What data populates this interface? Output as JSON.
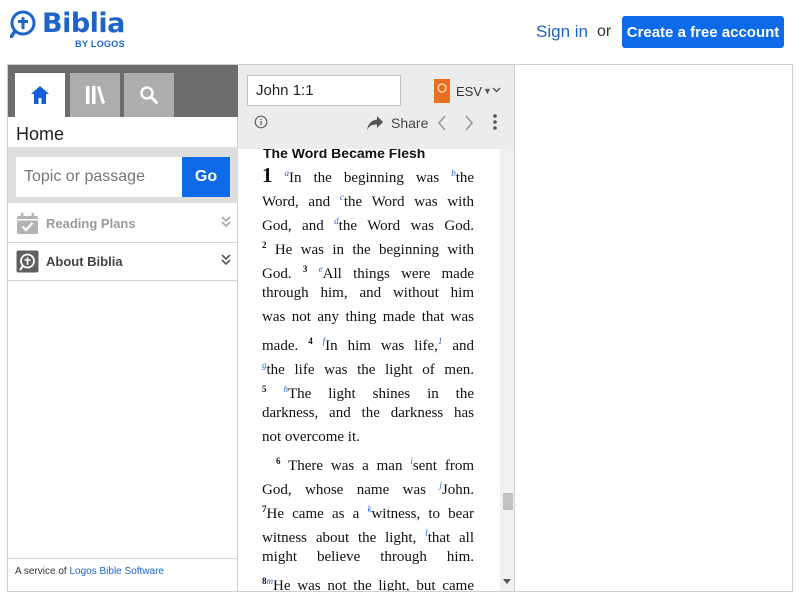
{
  "header": {
    "logo_title": "Biblia",
    "logo_sub": "BY LOGOS",
    "signin": "Sign in",
    "or": "or",
    "create_account": "Create a free account",
    "accent": "#0d6ae8"
  },
  "left_panel": {
    "tabs": [
      "home-icon",
      "library-icon",
      "search-icon"
    ],
    "home_heading": "Home",
    "search": {
      "placeholder": "Topic or passage",
      "go_label": "Go"
    },
    "menu": [
      {
        "label": "Reading Plans",
        "icon": "calendar-check-icon"
      },
      {
        "label": "About Biblia",
        "icon": "biblia-icon"
      }
    ],
    "footer": {
      "prefix": "A service of",
      "link": "Logos Bible Software"
    }
  },
  "reader": {
    "reference": "John 1:1",
    "version": "ESV",
    "share_label": "Share",
    "section_heading": "The Word Became Flesh",
    "text": {
      "ch_num": "1",
      "fn": {
        "a": "a",
        "b": "b",
        "c": "c",
        "d": "d",
        "e": "e",
        "f": "f",
        "g": "g",
        "h": "h",
        "i": "i",
        "j": "j",
        "k": "k",
        "l": "l",
        "m": "m",
        "one": "1"
      },
      "v": {
        "2": "2",
        "3": "3",
        "4": "4",
        "5": "5",
        "6": "6",
        "7": "7",
        "8": "8"
      },
      "t1a": "In the beginning was ",
      "t1b": "the",
      "t2a": "Word, and ",
      "t2b": "the Word was with",
      "t3a": "God, and ",
      "t3b": "the Word was God.",
      "t4": " He was in the beginning with",
      "t5a": "God. ",
      "t5b": "All things were made",
      "t6": "through him, and without him",
      "t7": "was not any thing made that was",
      "t8a": "made. ",
      "t8b": "In him was life,",
      "t8c": " and",
      "t9": "the life was the light of men.",
      "t10": "The light shines in the",
      "t11": "darkness, and the darkness has",
      "t12": "not overcome it.",
      "t13a": " There was a man ",
      "t13b": "sent from",
      "t14a": "God, whose name was ",
      "t14b": "John.",
      "t15a": "He came as a ",
      "t15b": "witness, to bear",
      "t16a": "witness about the light, ",
      "t16b": "that all",
      "t17": "might believe through him.",
      "t18": "He was not the light, but came"
    }
  }
}
